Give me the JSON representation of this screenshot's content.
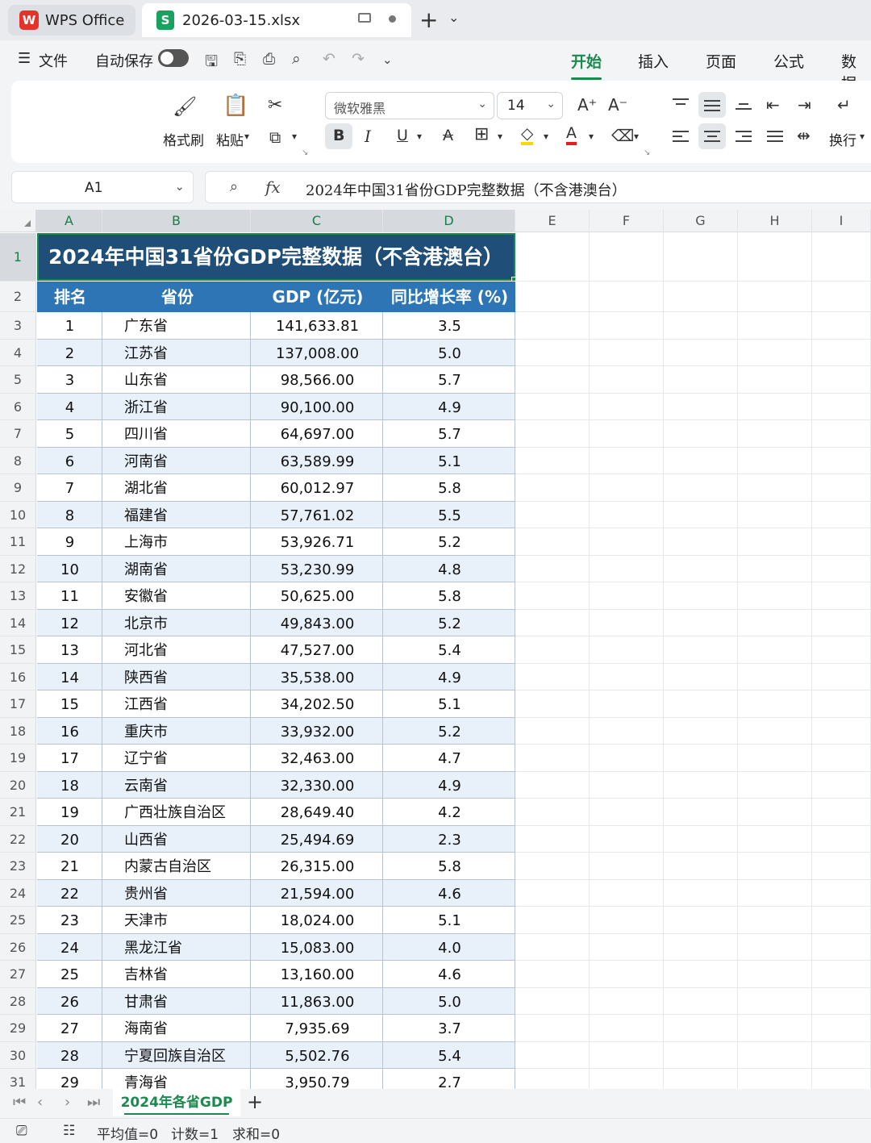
{
  "tabs": {
    "app_label": "WPS Office",
    "doc_label": "2026-03-15.xlsx",
    "new_tab": "+",
    "new_tab_menu": "⌄"
  },
  "menu": {
    "file": "文件",
    "autosave": "自动保存",
    "autosave_on": false,
    "ribbon_tabs": [
      "开始",
      "插入",
      "页面",
      "公式",
      "数据"
    ],
    "active_tab": "开始"
  },
  "ribbon": {
    "format_painter": "格式刷",
    "paste": "粘贴",
    "font_name": "微软雅黑",
    "font_size": "14",
    "wrap_text": "换行"
  },
  "formula_bar": {
    "cell_ref": "A1",
    "fx": "fx",
    "content": "2024年中国31省份GDP完整数据（不含港澳台）"
  },
  "columns": [
    "A",
    "B",
    "C",
    "D",
    "E",
    "F",
    "G",
    "H",
    "I"
  ],
  "sheet": {
    "title": "2024年中国31省份GDP完整数据（不含港澳台）",
    "headers": [
      "排名",
      "省份",
      "GDP (亿元)",
      "同比增长率 (%)"
    ],
    "rows": [
      [
        "1",
        "广东省",
        "141,633.81",
        "3.5"
      ],
      [
        "2",
        "江苏省",
        "137,008.00",
        "5.0"
      ],
      [
        "3",
        "山东省",
        "98,566.00",
        "5.7"
      ],
      [
        "4",
        "浙江省",
        "90,100.00",
        "4.9"
      ],
      [
        "5",
        "四川省",
        "64,697.00",
        "5.7"
      ],
      [
        "6",
        "河南省",
        "63,589.99",
        "5.1"
      ],
      [
        "7",
        "湖北省",
        "60,012.97",
        "5.8"
      ],
      [
        "8",
        "福建省",
        "57,761.02",
        "5.5"
      ],
      [
        "9",
        "上海市",
        "53,926.71",
        "5.2"
      ],
      [
        "10",
        "湖南省",
        "53,230.99",
        "4.8"
      ],
      [
        "11",
        "安徽省",
        "50,625.00",
        "5.8"
      ],
      [
        "12",
        "北京市",
        "49,843.00",
        "5.2"
      ],
      [
        "13",
        "河北省",
        "47,527.00",
        "5.4"
      ],
      [
        "14",
        "陕西省",
        "35,538.00",
        "4.9"
      ],
      [
        "15",
        "江西省",
        "34,202.50",
        "5.1"
      ],
      [
        "16",
        "重庆市",
        "33,932.00",
        "5.2"
      ],
      [
        "17",
        "辽宁省",
        "32,463.00",
        "4.7"
      ],
      [
        "18",
        "云南省",
        "32,330.00",
        "4.9"
      ],
      [
        "19",
        "广西壮族自治区",
        "28,649.40",
        "4.2"
      ],
      [
        "20",
        "山西省",
        "25,494.69",
        "2.3"
      ],
      [
        "21",
        "内蒙古自治区",
        "26,315.00",
        "5.8"
      ],
      [
        "22",
        "贵州省",
        "21,594.00",
        "4.6"
      ],
      [
        "23",
        "天津市",
        "18,024.00",
        "5.1"
      ],
      [
        "24",
        "黑龙江省",
        "15,083.00",
        "4.0"
      ],
      [
        "25",
        "吉林省",
        "13,160.00",
        "4.6"
      ],
      [
        "26",
        "甘肃省",
        "11,863.00",
        "5.0"
      ],
      [
        "27",
        "海南省",
        "7,935.69",
        "3.7"
      ],
      [
        "28",
        "宁夏回族自治区",
        "5,502.76",
        "5.4"
      ],
      [
        "29",
        "青海省",
        "3,950.79",
        "2.7"
      ]
    ]
  },
  "sheet_tabs": {
    "active": "2024年各省GDP",
    "add": "+"
  },
  "status": {
    "average": "平均值=0",
    "count": "计数=1",
    "sum": "求和=0"
  },
  "colors": {
    "title_bg": "#1f4e79",
    "header_bg": "#2e75b6",
    "band": "#e8f0fa",
    "accent": "#1a8a4e"
  }
}
